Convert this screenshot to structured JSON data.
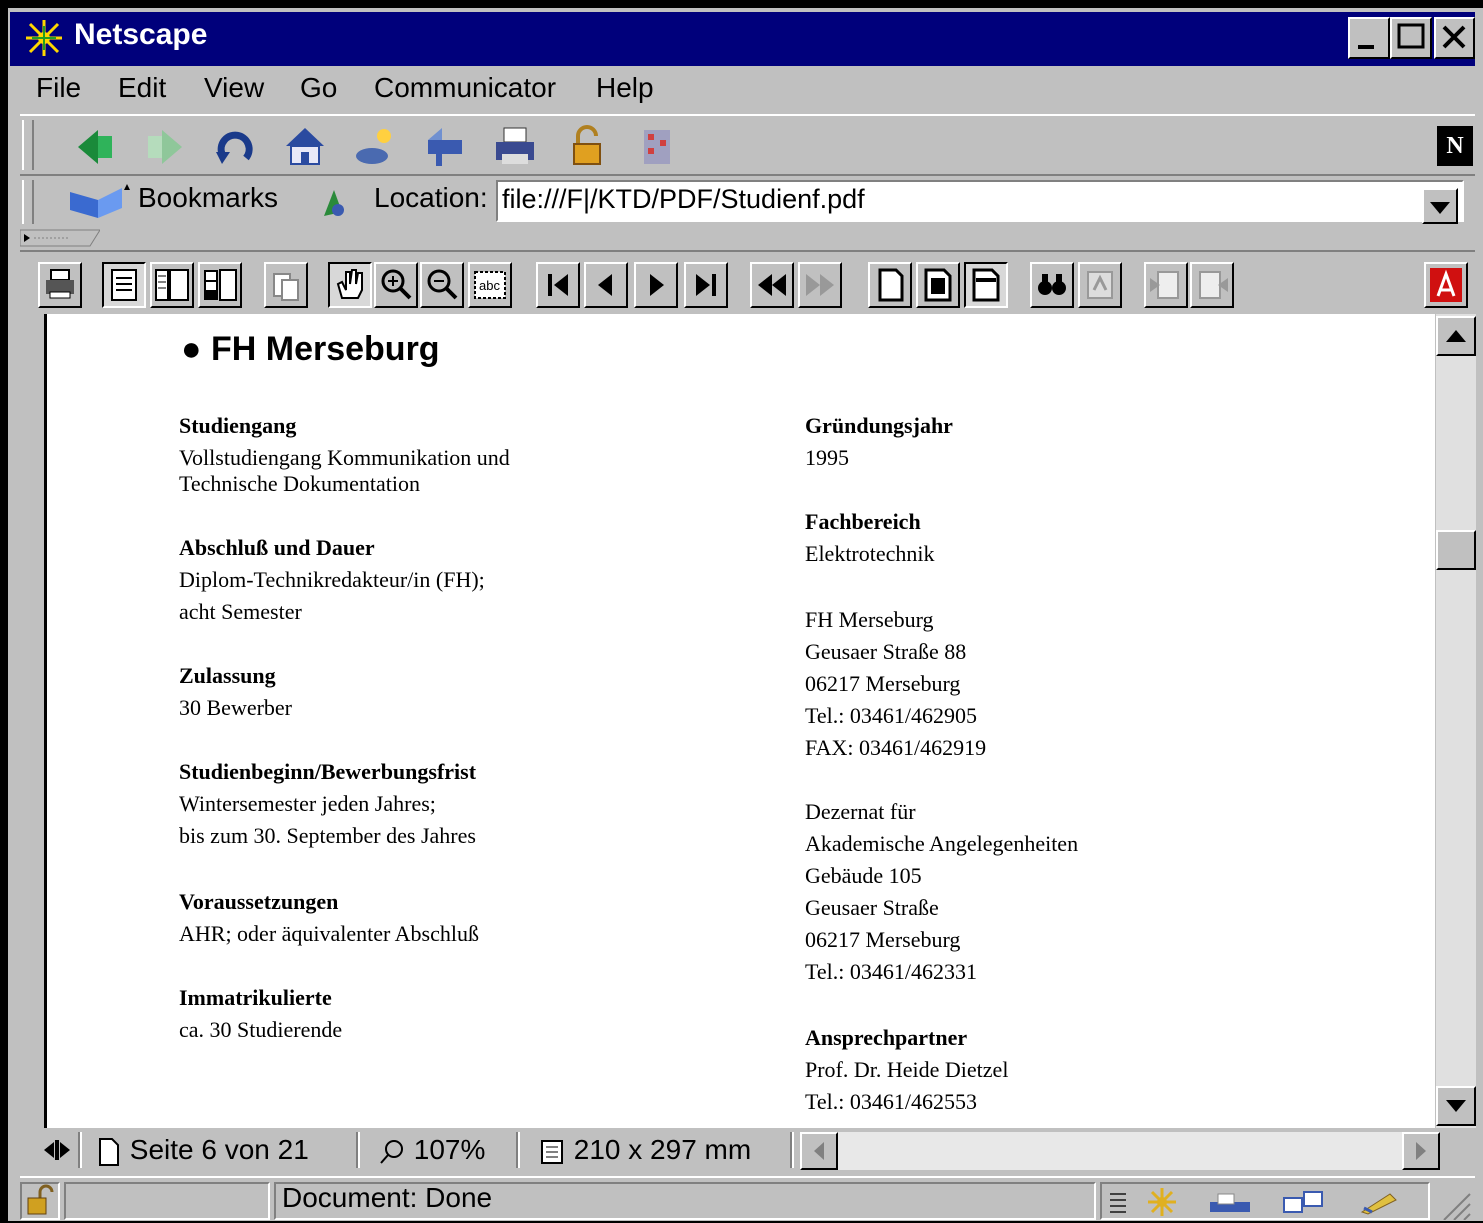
{
  "window": {
    "title": "Netscape"
  },
  "menu": [
    "File",
    "Edit",
    "View",
    "Go",
    "Communicator",
    "Help"
  ],
  "location_bar": {
    "bookmarks_label": "Bookmarks",
    "location_label": "Location:",
    "url": "file:///F|/KTD/PDF/Studienf.pdf"
  },
  "document": {
    "heading": "FH Merseburg",
    "left": [
      {
        "label": "Studiengang",
        "lines": [
          "Vollstudiengang Kommunikation und",
          "Technische Dokumentation"
        ]
      },
      {
        "label": "Abschluß und Dauer",
        "lines": [
          "Diplom-Technikredakteur/in (FH);",
          "acht Semester"
        ]
      },
      {
        "label": "Zulassung",
        "lines": [
          "30 Bewerber"
        ]
      },
      {
        "label": "Studienbeginn/Bewerbungsfrist",
        "lines": [
          "Wintersemester jeden Jahres;",
          "bis zum 30. September des Jahres"
        ]
      },
      {
        "label": "Voraussetzungen",
        "lines": [
          "AHR; oder äquivalenter Abschluß"
        ]
      },
      {
        "label": "Immatrikulierte",
        "lines": [
          "ca. 30 Studierende"
        ]
      }
    ],
    "right": [
      {
        "label": "Gründungsjahr",
        "lines": [
          "1995"
        ]
      },
      {
        "label": "Fachbereich",
        "lines": [
          "Elektrotechnik"
        ]
      },
      {
        "label": "",
        "lines": [
          "FH Merseburg",
          "Geusaer Straße 88",
          "06217 Merseburg",
          "Tel.: 03461/462905",
          "FAX: 03461/462919"
        ]
      },
      {
        "label": "",
        "lines": [
          "Dezernat für",
          "Akademische Angelegenheiten",
          "Gebäude 105",
          "Geusaer Straße",
          "06217 Merseburg",
          "Tel.: 03461/462331"
        ]
      },
      {
        "label": "Ansprechpartner",
        "lines": [
          "Prof. Dr. Heide Dietzel",
          "Tel.: 03461/462553"
        ]
      }
    ]
  },
  "pdf_status": {
    "page": "Seite 6 von 21",
    "zoom": "107%",
    "size": "210 x 297 mm"
  },
  "status": {
    "text": "Document: Done"
  }
}
